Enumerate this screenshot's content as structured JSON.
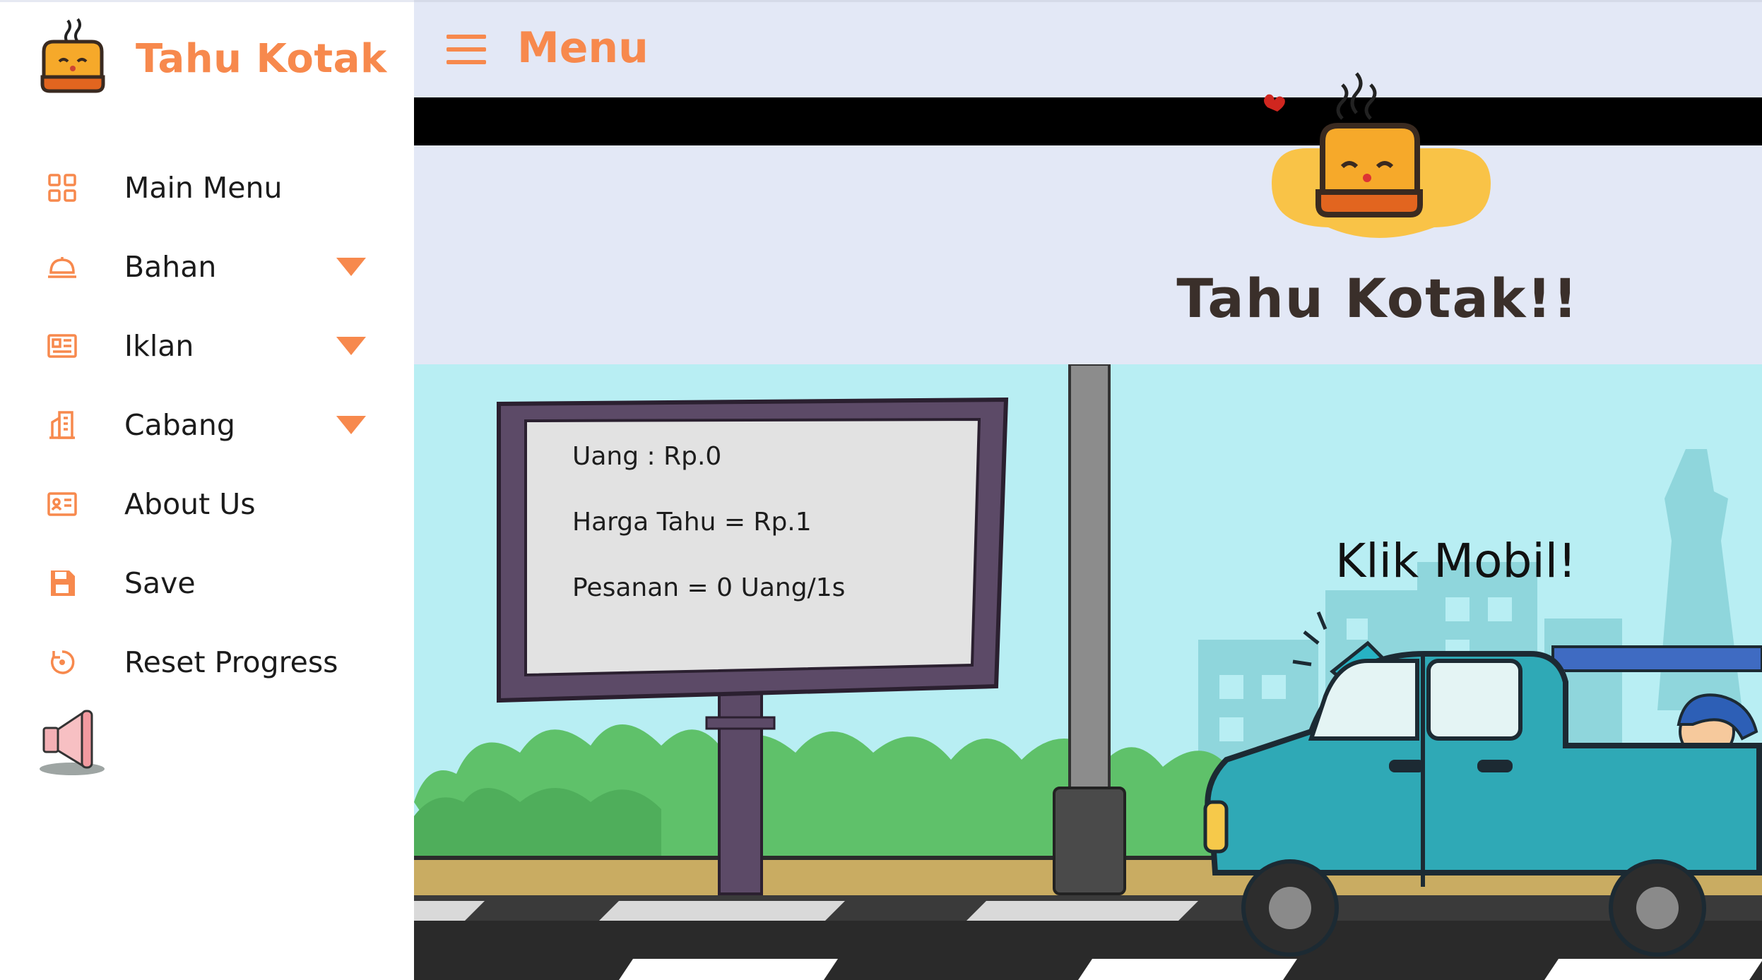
{
  "sidebar": {
    "brand_name": "Tahu Kotak",
    "items": [
      {
        "label": "Main Menu",
        "icon": "grid-icon"
      },
      {
        "label": "Bahan",
        "icon": "cloche-icon",
        "has_dropdown": true
      },
      {
        "label": "Iklan",
        "icon": "newspaper-icon",
        "has_dropdown": true
      },
      {
        "label": "Cabang",
        "icon": "building-icon",
        "has_dropdown": true
      },
      {
        "label": "About Us",
        "icon": "id-card-icon"
      },
      {
        "label": "Save",
        "icon": "floppy-disk-icon"
      },
      {
        "label": "Reset Progress",
        "icon": "reset-icon"
      }
    ],
    "speaker_icon": "megaphone-icon"
  },
  "topbar": {
    "title": "Menu",
    "menu_icon": "hamburger-icon"
  },
  "header": {
    "title": "Tahu Kotak!!"
  },
  "scene": {
    "billboard": {
      "uang": "Uang : Rp.0",
      "harga": "Harga Tahu = Rp.1",
      "pesanan": "Pesanan = 0 Uang/1s"
    },
    "car_prompt": "Klik Mobil!"
  },
  "colors": {
    "accent": "#f7894d",
    "header_bg": "#e3e8f6",
    "sky": "#b8eef3",
    "car": "#2fa9b6"
  }
}
